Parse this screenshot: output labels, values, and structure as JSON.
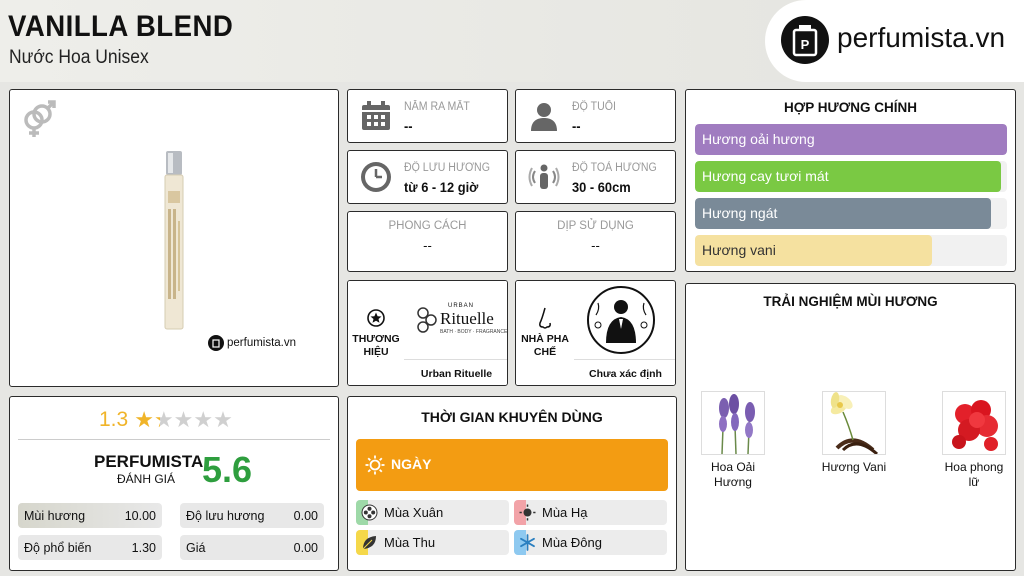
{
  "header": {
    "title": "VANILLA BLEND",
    "subtitle": "Nước Hoa Unisex",
    "brand": "perfumista.vn"
  },
  "product": {
    "watermark": "perfumista.vn",
    "gender_icon": "unisex-gender-icon"
  },
  "info": {
    "release": {
      "label": "NĂM RA MẮT",
      "value": "--",
      "icon": "calendar-icon"
    },
    "age": {
      "label": "ĐỘ TUỔI",
      "value": "--",
      "icon": "person-icon"
    },
    "longevity": {
      "label": "ĐỘ LƯU HƯƠNG",
      "value": "từ 6 - 12 giờ",
      "icon": "clock-icon"
    },
    "sillage": {
      "label": "ĐỘ TOẢ HƯƠNG",
      "value": "30 - 60cm",
      "icon": "sillage-icon"
    },
    "style": {
      "label": "PHONG CÁCH",
      "value": "--"
    },
    "occasion": {
      "label": "DỊP SỬ DỤNG",
      "value": "--"
    },
    "brand": {
      "label_line1": "THƯƠNG",
      "label_line2": "HIỆU",
      "name": "Urban Rituelle",
      "logo_top": "URBAN",
      "logo_main": "Rituelle",
      "logo_sub": "BATH · BODY · FRAGRANCE"
    },
    "perfumer": {
      "label_line1": "NHÀ PHA",
      "label_line2": "CHẾ",
      "name": "Chưa xác định"
    }
  },
  "accords": {
    "title": "HỢP HƯƠNG CHÍNH",
    "items": [
      {
        "label": "Hương oải hương",
        "percent": 100,
        "color": "#a07cc0"
      },
      {
        "label": "Hương cay tươi mát",
        "percent": 98,
        "color": "#7ac943"
      },
      {
        "label": "Hương ngát",
        "percent": 95,
        "color": "#7a8a98"
      },
      {
        "label": "Hương vani",
        "percent": 76,
        "color": "#f5e1a0"
      }
    ]
  },
  "experience": {
    "title": "TRẢI NGHIỆM MÙI HƯƠNG",
    "notes": [
      {
        "name_line1": "Hoa Oải",
        "name_line2": "Hương"
      },
      {
        "name_line1": "Hương Vani",
        "name_line2": ""
      },
      {
        "name_line1": "Hoa phong",
        "name_line2": "lữ"
      }
    ]
  },
  "rating": {
    "score": "1.3",
    "stars": 1.3,
    "max_stars": 5,
    "perfumista_label": "PERFUMISTA",
    "eval_label": "ĐÁNH GIÁ",
    "perfumista_score": "5.6",
    "stats": [
      {
        "label": "Mùi hương",
        "value": "10.00"
      },
      {
        "label": "Độ lưu hương",
        "value": "0.00"
      },
      {
        "label": "Độ phổ biến",
        "value": "1.30"
      },
      {
        "label": "Giá",
        "value": "0.00"
      }
    ]
  },
  "usage": {
    "title": "THỜI GIAN KHUYÊN DÙNG",
    "day_label": "NGÀY",
    "seasons": [
      {
        "label": "Mùa Xuân",
        "color": "#9ed9a8"
      },
      {
        "label": "Mùa Hạ",
        "color": "#f2a3a8"
      },
      {
        "label": "Mùa Thu",
        "color": "#f5d84a"
      },
      {
        "label": "Mùa Đông",
        "color": "#8ec9f0"
      }
    ]
  },
  "colors": {
    "accent_orange": "#f39c12",
    "score_green": "#2e9e3e",
    "star_gold": "#f0b429"
  }
}
